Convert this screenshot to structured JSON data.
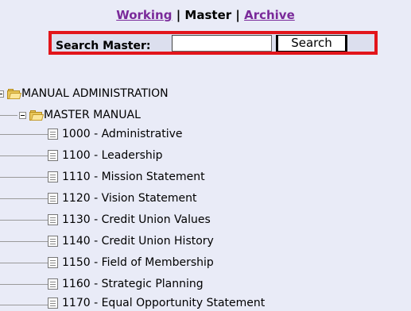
{
  "nav": {
    "working": "Working",
    "sep1": "|",
    "master": "Master",
    "sep2": "|",
    "archive": "Archive"
  },
  "search": {
    "label": "Search Master:",
    "value": "",
    "button": "Search"
  },
  "tree": {
    "root": "MANUAL ADMINISTRATION",
    "folder": "MASTER MANUAL",
    "items": [
      "1000 - Administrative",
      "1100 - Leadership",
      "1110 - Mission Statement",
      "1120 - Vision Statement",
      "1130 - Credit Union Values",
      "1140 - Credit Union History",
      "1150 - Field of Membership",
      "1160 - Strategic Planning",
      "1170 - Equal Opportunity Statement"
    ]
  },
  "colors": {
    "background": "#e9ebf7",
    "link": "#7a2a9a",
    "search_border": "#e2151b"
  }
}
